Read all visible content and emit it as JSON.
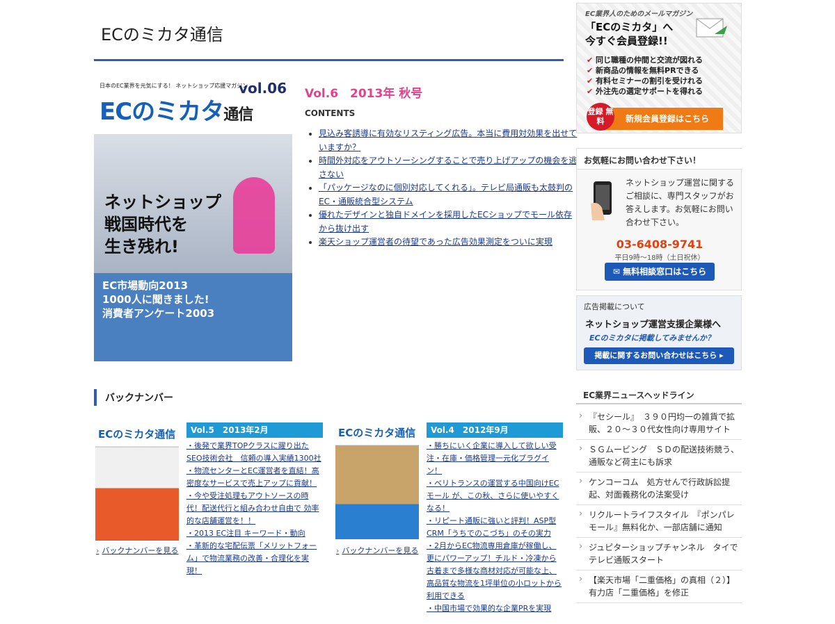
{
  "site": {
    "title": "ECのミカタ通信"
  },
  "cover": {
    "tagline": "日本のEC業界を元気にする！ ネットショップ応援マガジン",
    "vol": "vol.06",
    "logo_main": "ECのミカタ",
    "logo_sub": "通信",
    "headline_1": "ネットショップ",
    "headline_2": "戦国時代を",
    "headline_3": "生き残れ!",
    "sub_1": "EC市場動向2013",
    "sub_2": "1000人に聞きました!",
    "sub_3": "消費者アンケート2003"
  },
  "current_issue": {
    "heading": "Vol.6　2013年 秋号",
    "contents_label": "CONTENTS",
    "items": [
      "見込み客誘導に有効なリスティング広告。本当に費用対効果を出せていますか？",
      "時間外対応をアウトソーシングすることで売り上げアップの機会を逃さない",
      "「パッケージなのに個別対応してくれる」。テレビ局通販も太鼓判のEC・通販統合型システム",
      "優れたデザインと独自ドメインを採用したECショップでモール依存から抜け出す",
      "楽天ショップ運営者の待望であった広告効果測定をついに実現"
    ]
  },
  "backnumber": {
    "heading": "バックナンバー",
    "more_label": "バックナンバーを見る",
    "issues": [
      {
        "label": "Vol.5　2013年2月",
        "thumb_logo": "ECのミカタ通信",
        "items": [
          "・後発で業界TOPクラスに躍り出たSEO技術会社　信頼の導入実績1300社",
          "・物流センターとEC運営者を直結！高密度なサービスで売上アップに貢献！",
          "・今や受注処理もアウトソースの時代！配送代行と組み合わせ自由で 効率的な店舗運営を！！",
          "・2013 EC注目 キーワード・動向",
          "・革新的な宅配伝票「メリットフォーム」で物流業務の改善・合理化を実現！"
        ]
      },
      {
        "label": "Vol.4　2012年9月",
        "thumb_logo": "ECのミカタ通信",
        "items": [
          "・勝ちにいく企業に導入して欲しい受注・在庫・価格管理一元化プラグイン！",
          "・ベリトランスの運営する中国向けECモール が、この秋、さらに使いやすくなる！",
          "・リピート通販に強いと評判！ASP型CRM「うちでのこづち」のその実力",
          "・2月からEC物流専用倉庫が稼働し、更にパワーアップ！チルド・冷凍から古着まで多様な商材対応が可能な上、高品質な物流を1坪単位の小ロットから利用できる",
          "・中国市場で効果的な企業PRを実現"
        ]
      }
    ]
  },
  "sidebar": {
    "magazine": {
      "kicker": "EC業界人のためのメールマガジン",
      "title_1": "「ECのミカタ」へ",
      "title_2": "今すぐ会員登録!!",
      "benefits": [
        "同じ職種の仲間と交流が図れる",
        "新商品の情報を無料PRできる",
        "有料セミナーの割引を受けれる",
        "外注先の選定サポートを得れる"
      ],
      "badge": "登録 無料",
      "cta": "新規会員登録はこちら"
    },
    "contact": {
      "heading": "お気軽にお問い合わせ下さい！",
      "text": "ネットショップ運営に関するご相談に、専門スタッフがお答えします。お気軽にお問い合わせ下さい。",
      "tel": "03-6408-9741",
      "hours": "平日9時〜18時（土日祝休）",
      "button": "無料相談窓口はこちら"
    },
    "ad": {
      "label": "広告掲載について",
      "title": "ネットショップ運営支援企業様へ",
      "sub": "ECのミカタに掲載してみませんか？",
      "button": "掲載に関するお問い合わせはこちら"
    },
    "news": {
      "heading": "EC業界ニュースヘッドライン",
      "items": [
        "『セシール』　３９０円均一の雑貨で拡販、２０～３０代女性向け専用サイト",
        "ＳＧムービング　ＳＤの配送技術競う、通販など荷主にも訴求",
        "ケンコーコム　処方せんで行政訴訟提起、対面義務化の法案受け",
        "リクルートライフスタイル　『ポンパレモール』無料化か、一部店舗に通知",
        "ジュピターショップチャンネル　タイでテレビ通販スタート",
        "【楽天市場「二重価格」の真相（２）】 有力店「二重価格」を修正"
      ]
    }
  }
}
